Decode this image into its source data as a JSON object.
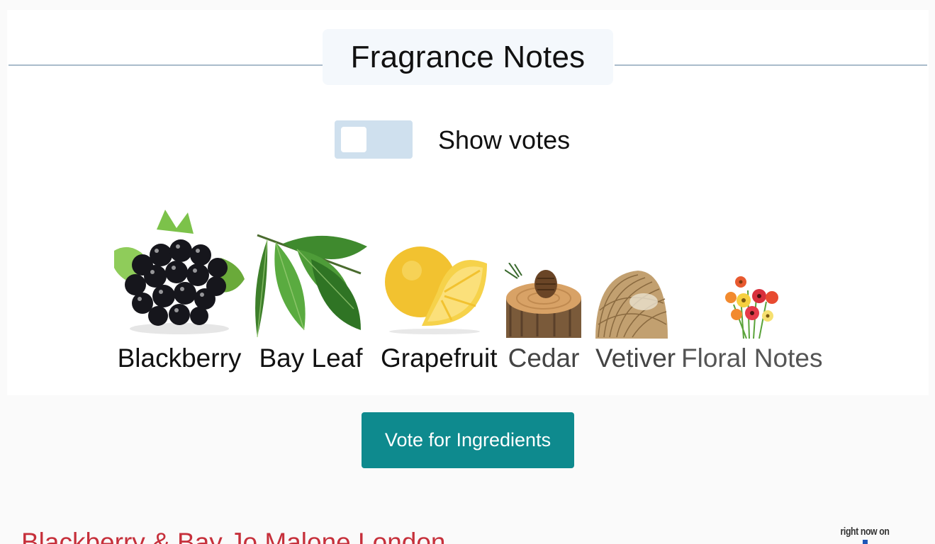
{
  "section": {
    "title": "Fragrance Notes"
  },
  "toggle": {
    "label": "Show votes",
    "checked": false
  },
  "notes": [
    {
      "name": "Blackberry",
      "image": "blackberry-icon",
      "color": "#111111"
    },
    {
      "name": "Bay Leaf",
      "image": "bay-leaf-icon",
      "color": "#111111"
    },
    {
      "name": "Grapefruit",
      "image": "grapefruit-icon",
      "color": "#111111"
    },
    {
      "name": "Cedar",
      "image": "cedar-icon",
      "color": "#444444"
    },
    {
      "name": "Vetiver",
      "image": "vetiver-icon",
      "color": "#444444"
    },
    {
      "name": "Floral Notes",
      "image": "floral-notes-icon",
      "color": "#555555"
    }
  ],
  "vote_button": {
    "label": "Vote for Ingredients",
    "color": "#0e8a8e"
  },
  "perfume_title": "Blackberry & Bay Jo Malone London",
  "badge": {
    "text": "right now on"
  }
}
